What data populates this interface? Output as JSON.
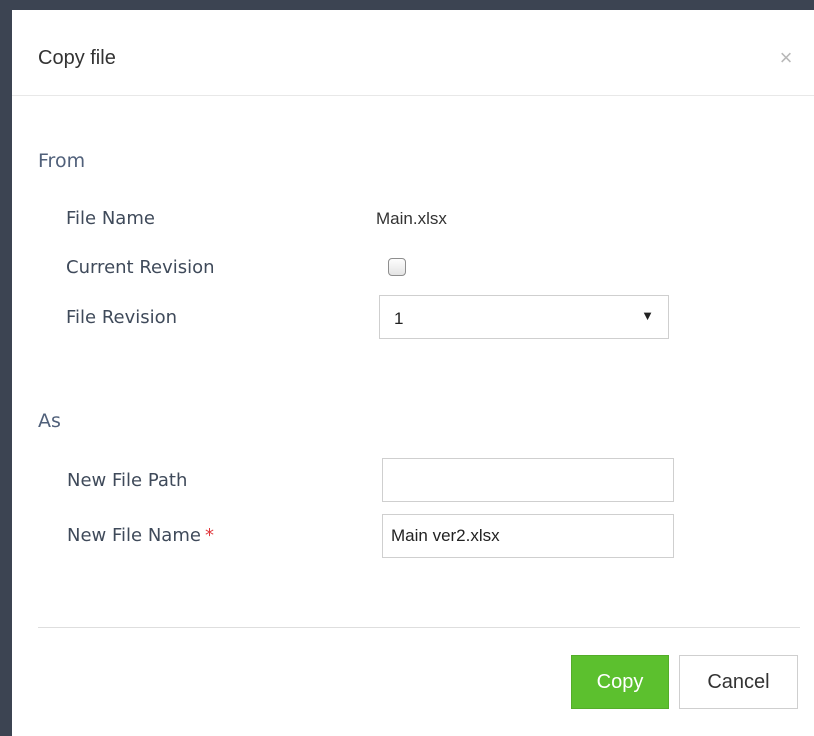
{
  "dialog": {
    "title": "Copy file",
    "close_icon": "close-icon",
    "close_glyph": "×"
  },
  "from_section": {
    "title": "From",
    "file_name_label": "File Name",
    "file_name_value": "Main.xlsx",
    "current_revision_label": "Current Revision",
    "current_revision_checked": false,
    "file_revision_label": "File Revision",
    "file_revision_value": "1",
    "dropdown_arrow_glyph": "▼"
  },
  "as_section": {
    "title": "As",
    "new_file_path_label": "New File Path",
    "new_file_path_value": "",
    "new_file_name_label": "New File Name",
    "required_marker": "*",
    "new_file_name_value": "Main ver2.xlsx"
  },
  "footer": {
    "copy_label": "Copy",
    "cancel_label": "Cancel"
  },
  "colors": {
    "primary_button": "#5cc02e",
    "required_star": "#e0393e",
    "section_title": "#50607a"
  }
}
